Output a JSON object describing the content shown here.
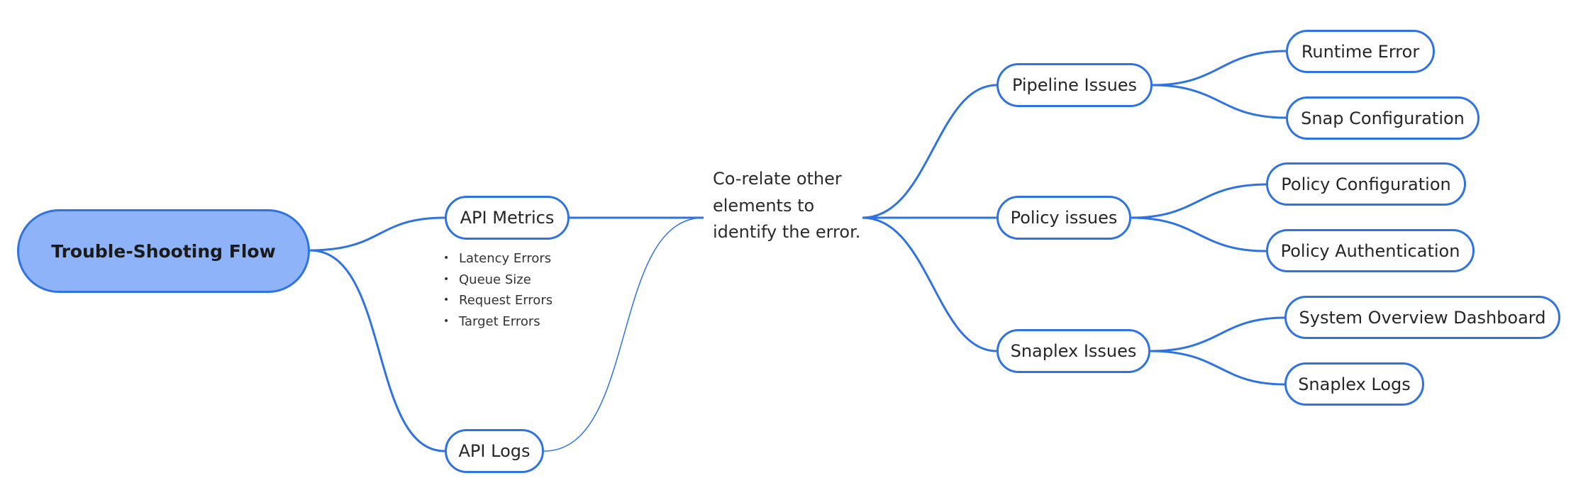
{
  "diagram": {
    "type": "mind-map",
    "colors": {
      "line": "#2f73e3",
      "node_border": "#2f73e3",
      "root_fill": "#8fb3f9",
      "node_fill": "#ffffff"
    },
    "root": {
      "label": "Trouble-Shooting Flow"
    },
    "left_branches": [
      {
        "label": "API Metrics",
        "details": [
          "Latency Errors",
          "Queue Size",
          "Request Errors",
          "Target Errors"
        ]
      },
      {
        "label": "API Logs"
      }
    ],
    "correlation_note": "Co-relate other elements to identify the error.",
    "right_branches": [
      {
        "label": "Pipeline Issues",
        "children": [
          "Runtime Error",
          "Snap Configuration"
        ]
      },
      {
        "label": "Policy issues",
        "children": [
          "Policy Configuration",
          "Policy Authentication"
        ]
      },
      {
        "label": "Snaplex Issues",
        "children": [
          "System Overview Dashboard",
          "Snaplex Logs"
        ]
      }
    ]
  }
}
